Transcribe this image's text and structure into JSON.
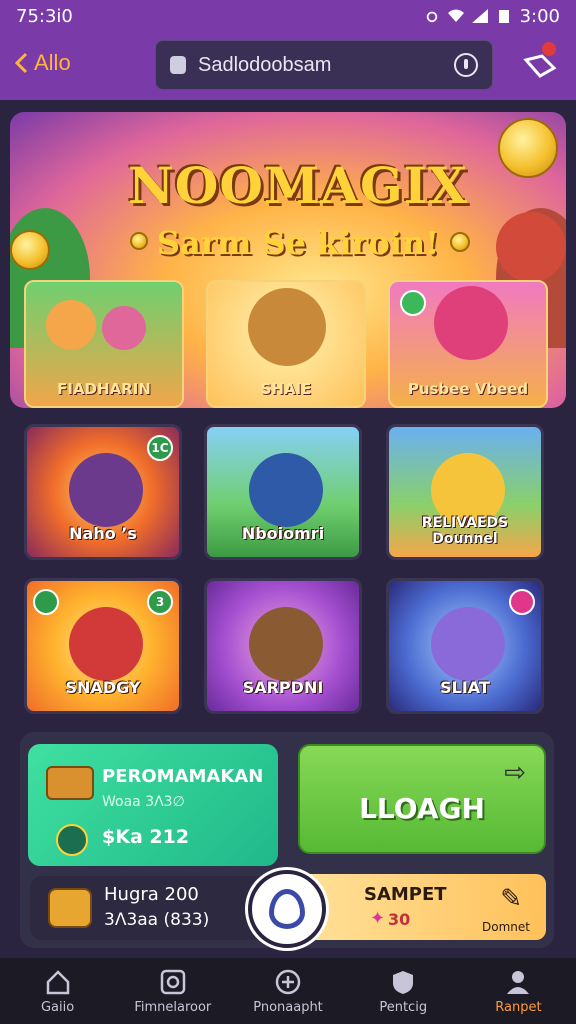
{
  "status_bar": {
    "time": "75:3i0",
    "right_time": "3:00"
  },
  "top_bar": {
    "back_label": "Allo",
    "search_text": "Sadlodoobsam"
  },
  "hero": {
    "title": "NOOMAGIX",
    "subtitle": "Sarm Se kiroin!",
    "cards": [
      {
        "label": "FIADHARIN"
      },
      {
        "label": "SHAIE"
      },
      {
        "label": "Pusbee Vbeed"
      }
    ]
  },
  "games": [
    {
      "label": "Naho ’s",
      "badge": "1C",
      "color": "#f06d2a",
      "char": "#6b3a8c"
    },
    {
      "label": "Nboiomri",
      "badge": "",
      "color": "#56b84e",
      "char": "#2e5aa8"
    },
    {
      "label": "RELIVAEDS Dounnel",
      "badge": "",
      "color": "#f5a64a",
      "char": "#f5c43a"
    },
    {
      "label": "SNADGY",
      "badge": "3",
      "color": "#ffb22e",
      "char": "#d23a3a"
    },
    {
      "label": "SARPDNI",
      "badge": "",
      "color": "#a34fd0",
      "char": "#8a5a32"
    },
    {
      "label": "SLIAT",
      "badge": "",
      "color": "#4b6ad0",
      "char": "#8a6ad8"
    }
  ],
  "promo": {
    "title": "PEROMAMAKAN",
    "subtitle": "Woaa 3Λ3∅",
    "amount": "$Ka 212"
  },
  "cta": {
    "label": "LLOAGH"
  },
  "balance": {
    "line1": "Hugra 200",
    "line2": "3Λ3aa (833)"
  },
  "ticket": {
    "title": "SAMPET",
    "value": "30",
    "caption": "Domnet"
  },
  "bottom_nav": [
    {
      "label": "Gaiio",
      "icon": "home-icon"
    },
    {
      "label": "Fimnelaroor",
      "icon": "games-icon"
    },
    {
      "label": "Pnonaapht",
      "icon": "plus-icon"
    },
    {
      "label": "Pentcig",
      "icon": "shield-icon"
    },
    {
      "label": "Ranpet",
      "icon": "profile-icon",
      "active": true
    }
  ]
}
